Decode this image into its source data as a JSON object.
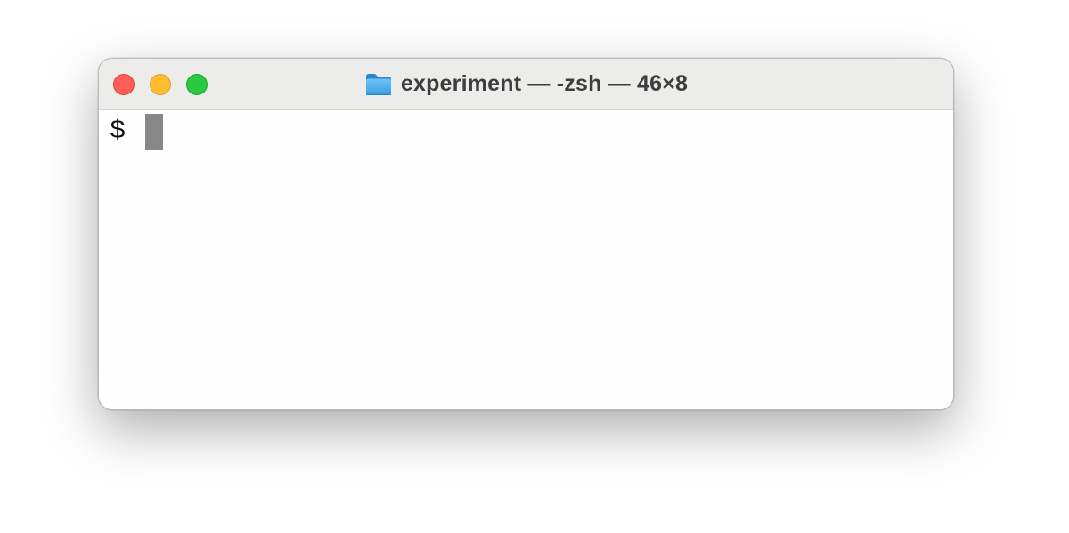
{
  "window": {
    "title": "experiment — -zsh — 46×8",
    "title_icon": "folder-icon"
  },
  "traffic_lights": {
    "close": {
      "color": "#ff5f57",
      "border": "#e0443e"
    },
    "minimize": {
      "color": "#febc2e",
      "border": "#dea123"
    },
    "zoom": {
      "color": "#28c840",
      "border": "#1aab29"
    }
  },
  "terminal": {
    "prompt": "$",
    "cursor_color": "#878787",
    "background": "#fefefe"
  }
}
